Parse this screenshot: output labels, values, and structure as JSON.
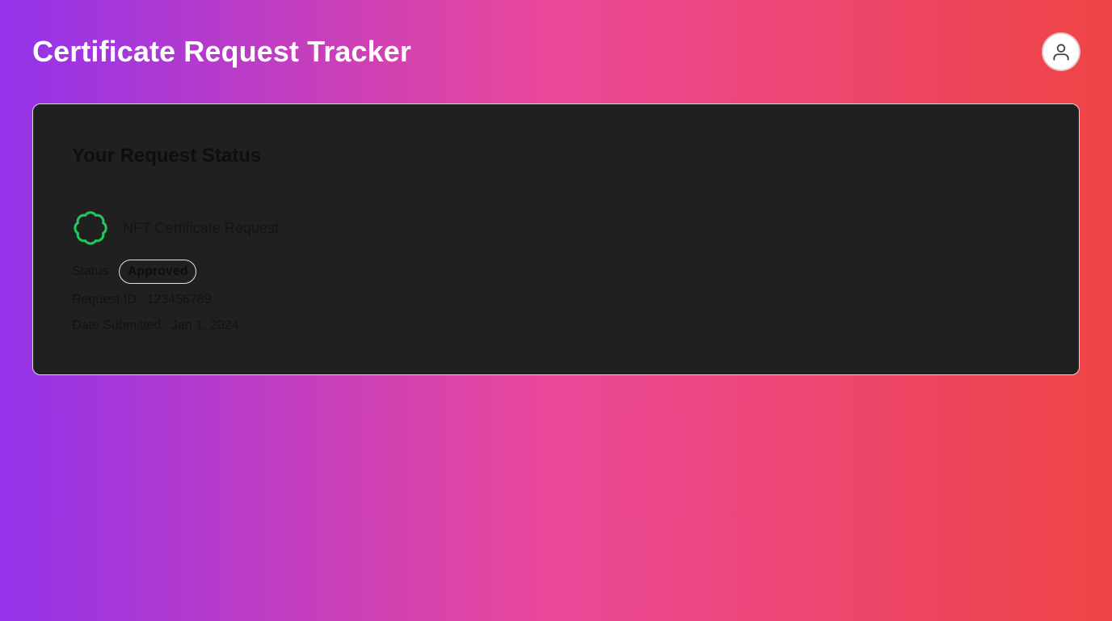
{
  "header": {
    "title": "Certificate Request Tracker",
    "avatar_icon": "user-icon"
  },
  "card": {
    "title": "Your Request Status",
    "request": {
      "icon": "badge-icon",
      "icon_color": "#22c55e",
      "name": "NFT Certificate Request"
    },
    "status": {
      "label": "Status:",
      "value": "Approved"
    },
    "request_id": {
      "label": "Request ID:",
      "value": "123456789"
    },
    "date_submitted": {
      "label": "Date Submitted:",
      "value": "Jan 1, 2024"
    }
  },
  "colors": {
    "gradient_start": "#9333ea",
    "gradient_mid": "#ec4899",
    "gradient_end": "#ef4444",
    "card_background": "#202020"
  }
}
